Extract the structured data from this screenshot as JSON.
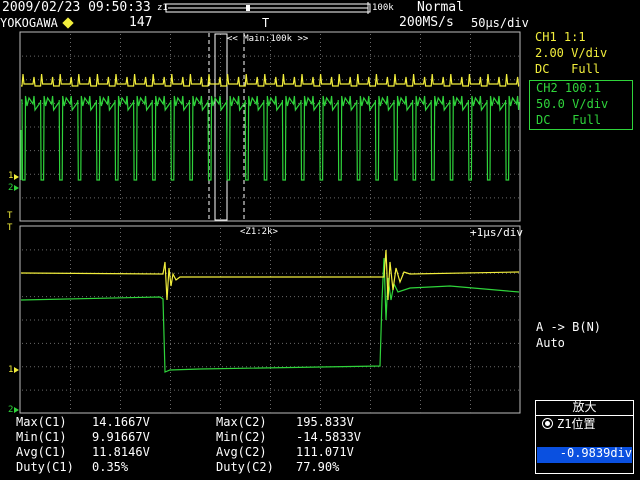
{
  "status_bar": {
    "datetime": "2009/02/23 09:50:33",
    "record_left": "z1",
    "record_right": "100k",
    "mode": "Normal"
  },
  "info_bar": {
    "brand": "YOKOGAWA",
    "acq_count": "147",
    "trigger_marker": "T",
    "sample_rate": "200MS/s",
    "timebase": "50μs/div"
  },
  "main_window": {
    "label": "<< Main:100k >>"
  },
  "zoom_window": {
    "label": "<Z1:2k>",
    "timebase": "+1μs/div"
  },
  "ch1": {
    "name": "CH1",
    "probe": "1:1",
    "vdiv": "2.00 V/div",
    "coupling": "DC",
    "bandwidth": "Full",
    "color": "#f2ee3c"
  },
  "ch2": {
    "name": "CH2",
    "probe": "100:1",
    "vdiv": "50.0 V/div",
    "coupling": "DC",
    "bandwidth": "Full",
    "color": "#2fd43b"
  },
  "cursor_info": {
    "line1": "A -> B(N)",
    "line2": "Auto"
  },
  "measurements": [
    {
      "label": "Max(C1)",
      "value": "14.1667V"
    },
    {
      "label": "Min(C1)",
      "value": "9.91667V"
    },
    {
      "label": "Avg(C1)",
      "value": "11.8146V"
    },
    {
      "label": "Duty(C1)",
      "value": "0.35%"
    },
    {
      "label": "Max(C2)",
      "value": "195.833V"
    },
    {
      "label": "Min(C2)",
      "value": "-14.5833V"
    },
    {
      "label": "Avg(C2)",
      "value": "111.071V"
    },
    {
      "label": "Duty(C2)",
      "value": "77.90%"
    }
  ],
  "zoom_panel": {
    "title": "放大",
    "z1_position_label": "Z1位置",
    "z1_position_value": "-0.9839div"
  },
  "icons": {
    "trigger": "trigger-marker-icon",
    "zoom_gear": "zoom-position-knob-icon"
  }
}
